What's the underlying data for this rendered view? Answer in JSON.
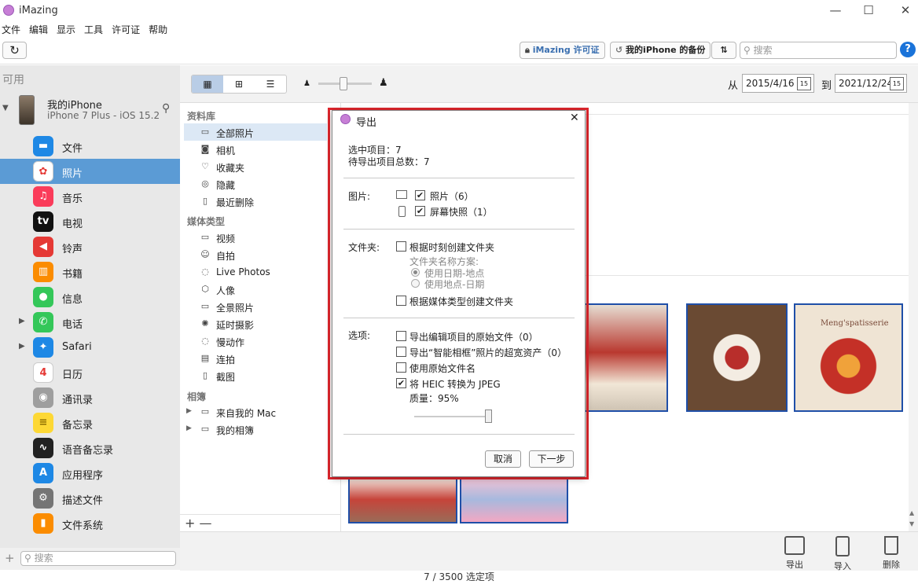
{
  "window": {
    "title": "iMazing",
    "minimize": "—",
    "maximize": "☐",
    "close": "✕"
  },
  "menu": [
    "文件",
    "编辑",
    "显示",
    "工具",
    "许可证",
    "帮助"
  ],
  "toolbar": {
    "refresh_icon": "↻",
    "license_label": "iMazing 许可证",
    "backup_label": "我的iPhone 的备份",
    "transfer_icon": "⇅",
    "search_placeholder": "搜索",
    "help": "?"
  },
  "sidebar": {
    "available": "可用",
    "device": {
      "name": "我的iPhone",
      "model": "iPhone 7 Plus - iOS 15.2",
      "usb_icon": "⚲"
    },
    "items": [
      {
        "label": "文件",
        "color": "#1e88e5",
        "glyph": "▬",
        "expand": false
      },
      {
        "label": "照片",
        "color": "#ffffff",
        "glyph": "✿",
        "expand": false,
        "selected": true
      },
      {
        "label": "音乐",
        "color": "#fa3c5a",
        "glyph": "♫",
        "expand": false
      },
      {
        "label": "电视",
        "color": "#111111",
        "glyph": "tv",
        "expand": false
      },
      {
        "label": "铃声",
        "color": "#e53935",
        "glyph": "◀",
        "expand": false
      },
      {
        "label": "书籍",
        "color": "#fb8c00",
        "glyph": "▥",
        "expand": false
      },
      {
        "label": "信息",
        "color": "#34c759",
        "glyph": "●",
        "expand": false
      },
      {
        "label": "电话",
        "color": "#34c759",
        "glyph": "✆",
        "expand": true
      },
      {
        "label": "Safari",
        "color": "#1e88e5",
        "glyph": "✦",
        "expand": true
      },
      {
        "label": "日历",
        "color": "#ffffff",
        "glyph": "4",
        "expand": false
      },
      {
        "label": "通讯录",
        "color": "#9e9e9e",
        "glyph": "◉",
        "expand": false
      },
      {
        "label": "备忘录",
        "color": "#fdd835",
        "glyph": "≡",
        "expand": false
      },
      {
        "label": "语音备忘录",
        "color": "#222222",
        "glyph": "∿",
        "expand": false
      },
      {
        "label": "应用程序",
        "color": "#1e88e5",
        "glyph": "A",
        "expand": false
      },
      {
        "label": "描述文件",
        "color": "#757575",
        "glyph": "⚙",
        "expand": false
      },
      {
        "label": "文件系统",
        "color": "#fb8c00",
        "glyph": "▮",
        "expand": false
      }
    ],
    "add": "+",
    "search_placeholder": "搜索"
  },
  "viewbar": {
    "from_label": "从",
    "from_date": "2015/4/16",
    "to_label": "到",
    "to_date": "2021/12/24",
    "cal_day": "15"
  },
  "library": {
    "sec_library": "资料库",
    "library_items": [
      {
        "label": "全部照片",
        "glyph": "▭",
        "selected": true
      },
      {
        "label": "相机",
        "glyph": "◙"
      },
      {
        "label": "收藏夹",
        "glyph": "♡"
      },
      {
        "label": "隐藏",
        "glyph": "◎"
      },
      {
        "label": "最近删除",
        "glyph": "▯"
      }
    ],
    "sec_media": "媒体类型",
    "media_items": [
      {
        "label": "视频",
        "glyph": "▭"
      },
      {
        "label": "自拍",
        "glyph": "☺"
      },
      {
        "label": "Live Photos",
        "glyph": "◌"
      },
      {
        "label": "人像",
        "glyph": "⬡"
      },
      {
        "label": "全景照片",
        "glyph": "▭"
      },
      {
        "label": "延时摄影",
        "glyph": "✺"
      },
      {
        "label": "慢动作",
        "glyph": "◌"
      },
      {
        "label": "连拍",
        "glyph": "▤"
      },
      {
        "label": "截图",
        "glyph": "▯"
      }
    ],
    "sec_albums": "相簿",
    "album_items": [
      {
        "label": "来自我的 Mac",
        "glyph": "▭"
      },
      {
        "label": "我的相簿",
        "glyph": "▭"
      }
    ],
    "footer": "+ —"
  },
  "actions": {
    "export": "导出",
    "import": "导入",
    "delete": "删除"
  },
  "status": "7 / 3500 选定项",
  "dialog": {
    "title": "导出",
    "selected": "选中项目：7",
    "total": "待导出项目总数：7",
    "pictures_label": "图片:",
    "photos": "照片（6）",
    "screenshots": "屏幕快照（1）",
    "folder_label": "文件夹:",
    "create_by_moment": "根据时刻创建文件夹",
    "naming_scheme": "文件夹名称方案:",
    "use_date_place": "使用日期-地点",
    "use_place_date": "使用地点-日期",
    "create_by_media": "根据媒体类型创建文件夹",
    "options_label": "选项:",
    "export_originals": "导出编辑项目的原始文件（0）",
    "export_smart": "导出“智能相框”照片的超宽资产（0）",
    "use_original_names": "使用原始文件名",
    "heic_to_jpeg": "将 HEIC 转换为 JPEG",
    "quality": "质量：95%",
    "cancel": "取消",
    "next": "下一步",
    "close": "✕"
  }
}
